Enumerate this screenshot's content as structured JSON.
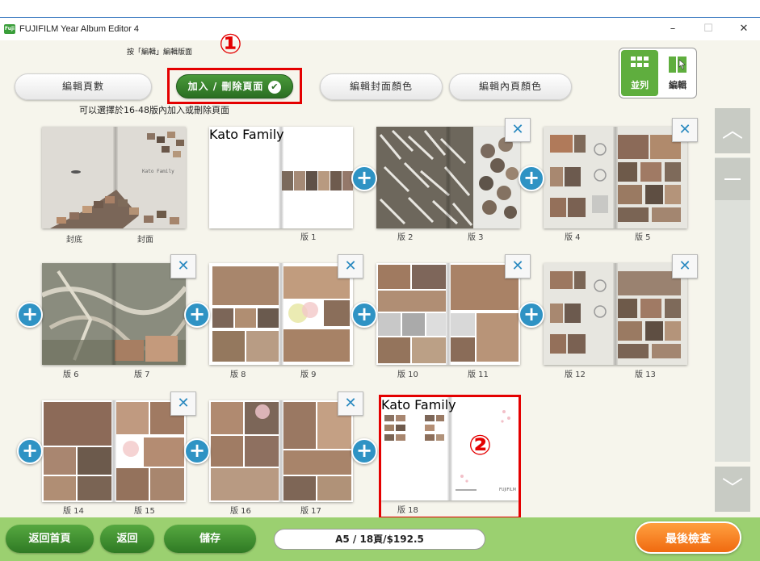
{
  "window": {
    "title": "FUJIFILM Year Album Editor 4",
    "logo_text": "Fuji",
    "min": "–",
    "max": "☐",
    "close": "✕"
  },
  "annotations": {
    "one": "①",
    "two": "②"
  },
  "hint_top": "按「編輯」編輯版面",
  "toolbar": {
    "edit_pages": "編輯頁數",
    "add_remove": "加入 / 刪除頁面",
    "edit_cover_color": "編輯封面顏色",
    "edit_inner_color": "編輯內頁顏色"
  },
  "range_hint": "可以選擇於16-48版內加入或刪除頁面",
  "view_toggle": {
    "grid_label": "並列",
    "edit_label": "編輯"
  },
  "cover_title": "Kato Family",
  "spreads": [
    {
      "left": "封底",
      "right": "封面"
    },
    {
      "left": "",
      "right": "版  1"
    },
    {
      "left": "版  2",
      "right": "版  3"
    },
    {
      "left": "版  4",
      "right": "版  5"
    },
    {
      "left": "版  6",
      "right": "版  7"
    },
    {
      "left": "版  8",
      "right": "版  9"
    },
    {
      "left": "版  10",
      "right": "版  11"
    },
    {
      "left": "版  12",
      "right": "版  13"
    },
    {
      "left": "版  14",
      "right": "版  15"
    },
    {
      "left": "版  16",
      "right": "版  17"
    },
    {
      "left": "版  18",
      "right": ""
    }
  ],
  "icons": {
    "plus": "+",
    "remove": "✕",
    "check": "✔",
    "scroll_up": "︿",
    "scroll_down": "﹀"
  },
  "back_brand": "FUJIFILM",
  "bottom": {
    "home": "返回首頁",
    "back": "返回",
    "save": "儲存",
    "status": "A5 / 18頁/$192.5",
    "final_check": "最後檢查"
  },
  "colors": {
    "accent_green": "#2a6e22",
    "plus_blue": "#2f93c4",
    "annotation_red": "#e40000",
    "bottom_bar": "#9bd070",
    "final_orange": "#f06a10"
  }
}
